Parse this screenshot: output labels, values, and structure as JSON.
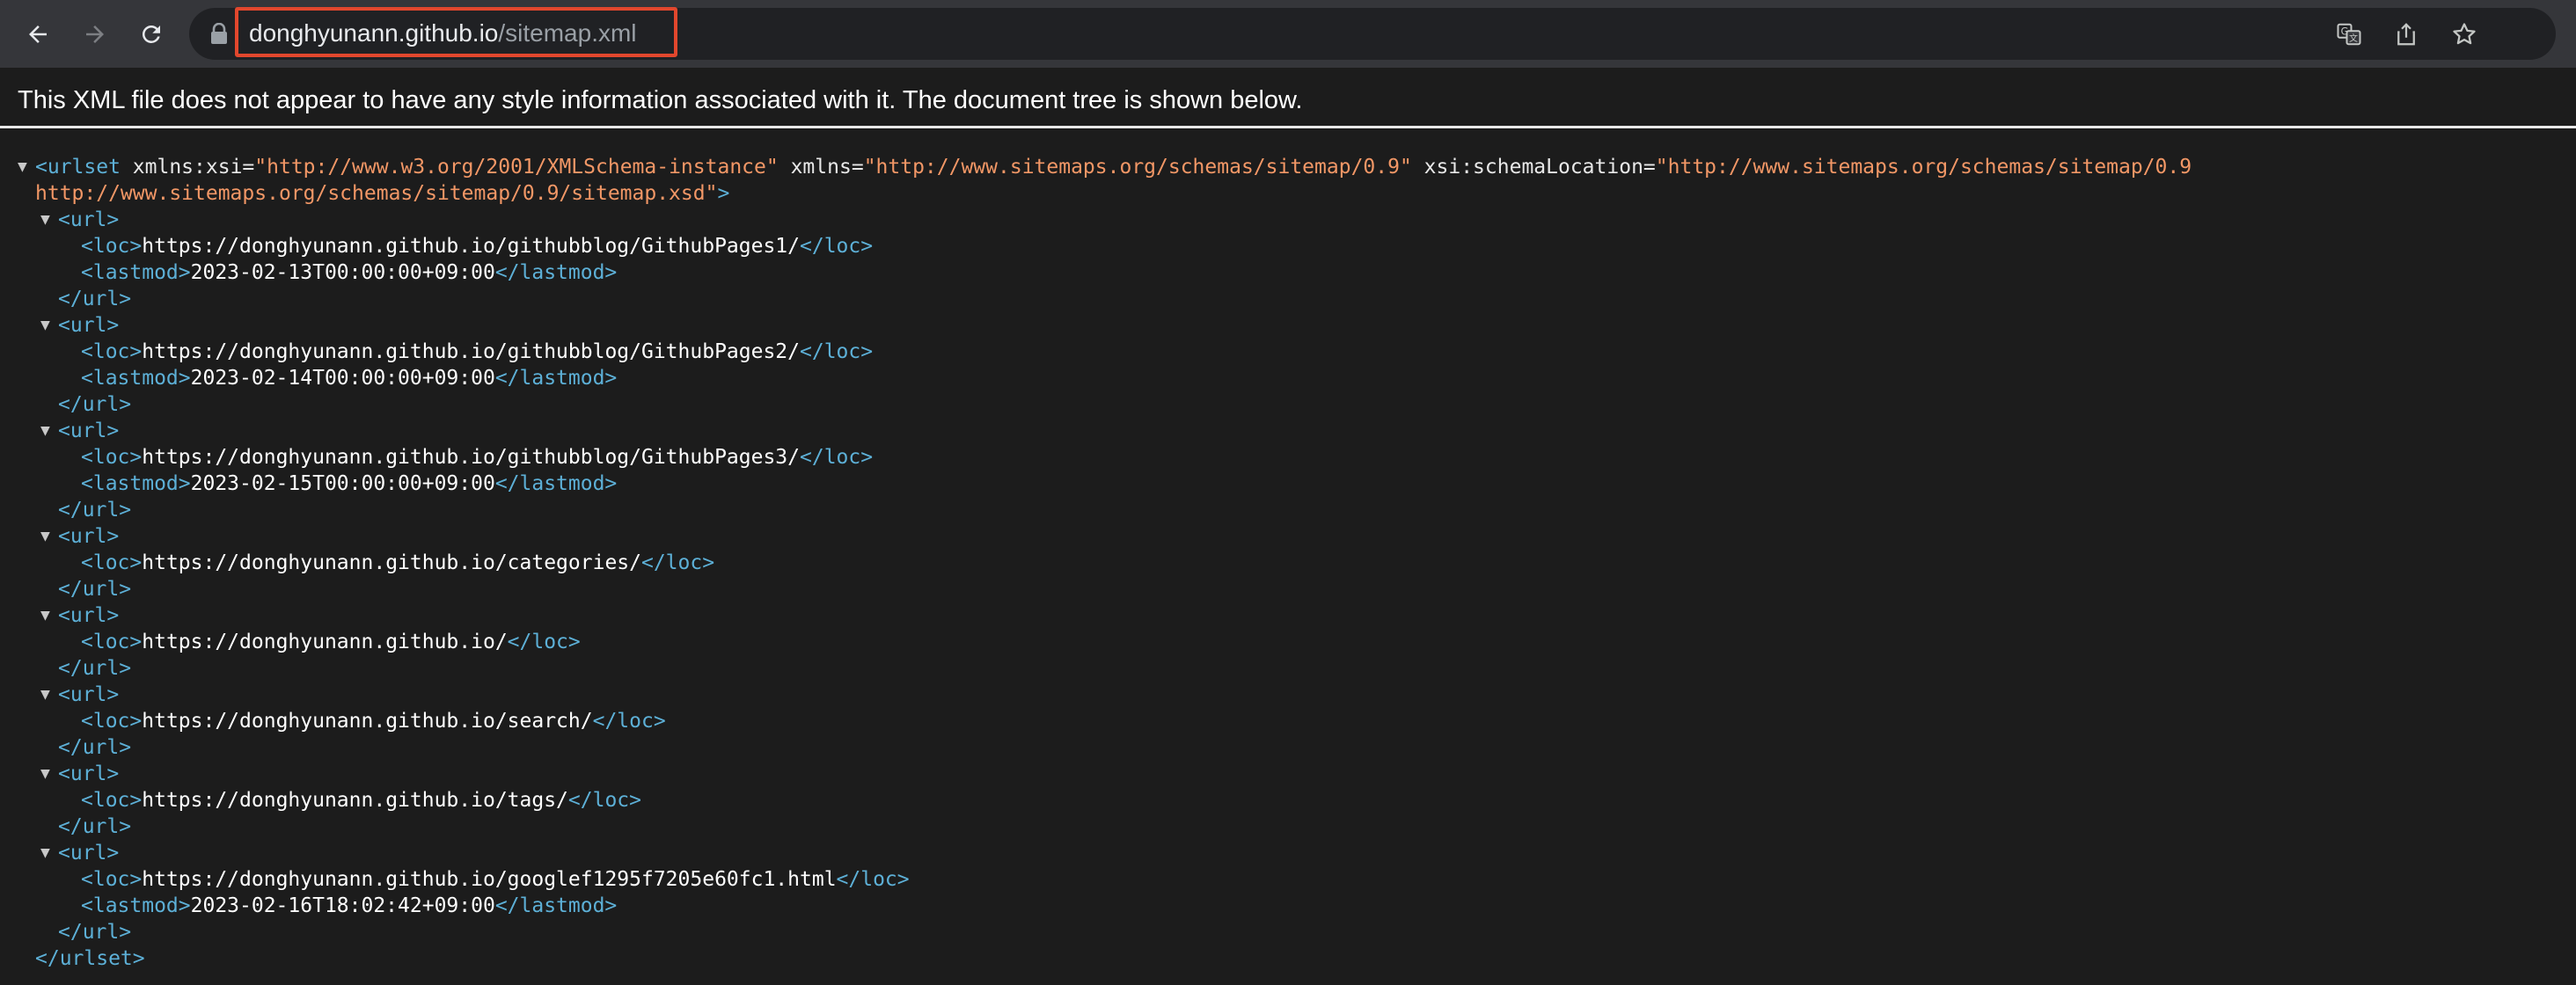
{
  "browser": {
    "url_host": "donghyunann.github.io",
    "url_path": "/sitemap.xml",
    "icons": {
      "back": "arrow-left-icon",
      "forward": "arrow-right-icon",
      "reload": "reload-icon",
      "lock": "lock-icon",
      "translate": "translate-icon",
      "share": "share-icon",
      "bookmark": "star-icon"
    }
  },
  "page": {
    "header": "This XML file does not appear to have any style information associated with it. The document tree is shown below.",
    "urlset": {
      "open_tag": "<urlset",
      "attrs": [
        {
          "name": "xmlns:xsi",
          "value": "\"http://www.w3.org/2001/XMLSchema-instance\""
        },
        {
          "name": "xmlns",
          "value": "\"http://www.sitemaps.org/schemas/sitemap/0.9\""
        },
        {
          "name": "xsi:schemaLocation",
          "value": "\"http://www.sitemaps.org/schemas/sitemap/0.9"
        }
      ],
      "attr_continuation": "http://www.sitemaps.org/schemas/sitemap/0.9/sitemap.xsd\"",
      "open_tag_end": ">",
      "close_tag": "</urlset>"
    },
    "tags": {
      "url_open": "<url>",
      "url_close": "</url>",
      "loc_open": "<loc>",
      "loc_close": "</loc>",
      "lastmod_open": "<lastmod>",
      "lastmod_close": "</lastmod>"
    },
    "urls": [
      {
        "loc": "https://donghyunann.github.io/githubblog/GithubPages1/",
        "lastmod": "2023-02-13T00:00:00+09:00"
      },
      {
        "loc": "https://donghyunann.github.io/githubblog/GithubPages2/",
        "lastmod": "2023-02-14T00:00:00+09:00"
      },
      {
        "loc": "https://donghyunann.github.io/githubblog/GithubPages3/",
        "lastmod": "2023-02-15T00:00:00+09:00"
      },
      {
        "loc": "https://donghyunann.github.io/categories/",
        "lastmod": null
      },
      {
        "loc": "https://donghyunann.github.io/",
        "lastmod": null
      },
      {
        "loc": "https://donghyunann.github.io/search/",
        "lastmod": null
      },
      {
        "loc": "https://donghyunann.github.io/tags/",
        "lastmod": null
      },
      {
        "loc": "https://donghyunann.github.io/googlef1295f7205e60fc1.html",
        "lastmod": "2023-02-16T18:02:42+09:00"
      }
    ],
    "toggle_glyph": "▼"
  },
  "colors": {
    "toolbar_bg": "#35363a",
    "omnibox_bg": "#202124",
    "page_bg": "#1c1c1c",
    "tag": "#5db0d7",
    "attr_value": "#f29766",
    "highlight_box": "#e2472d"
  }
}
